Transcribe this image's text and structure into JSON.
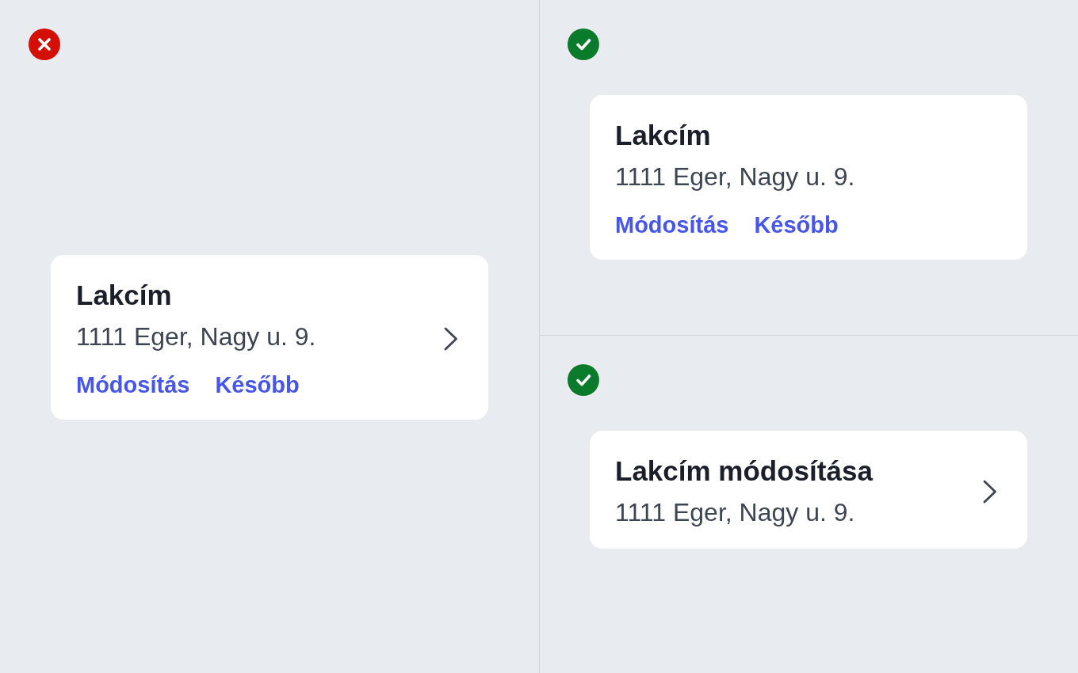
{
  "examples": [
    {
      "kind": "incorrect",
      "card": {
        "title": "Lakcím",
        "address": "1111 Eger, Nagy u. 9.",
        "actions": [
          "Módosítás",
          "Később"
        ],
        "chevron": true
      }
    },
    {
      "kind": "correct",
      "card": {
        "title": "Lakcím",
        "address": "1111 Eger, Nagy u. 9.",
        "actions": [
          "Módosítás",
          "Később"
        ],
        "chevron": false
      }
    },
    {
      "kind": "correct",
      "card": {
        "title": "Lakcím módosítása",
        "address": "1111 Eger, Nagy u. 9.",
        "chevron": true
      }
    }
  ]
}
